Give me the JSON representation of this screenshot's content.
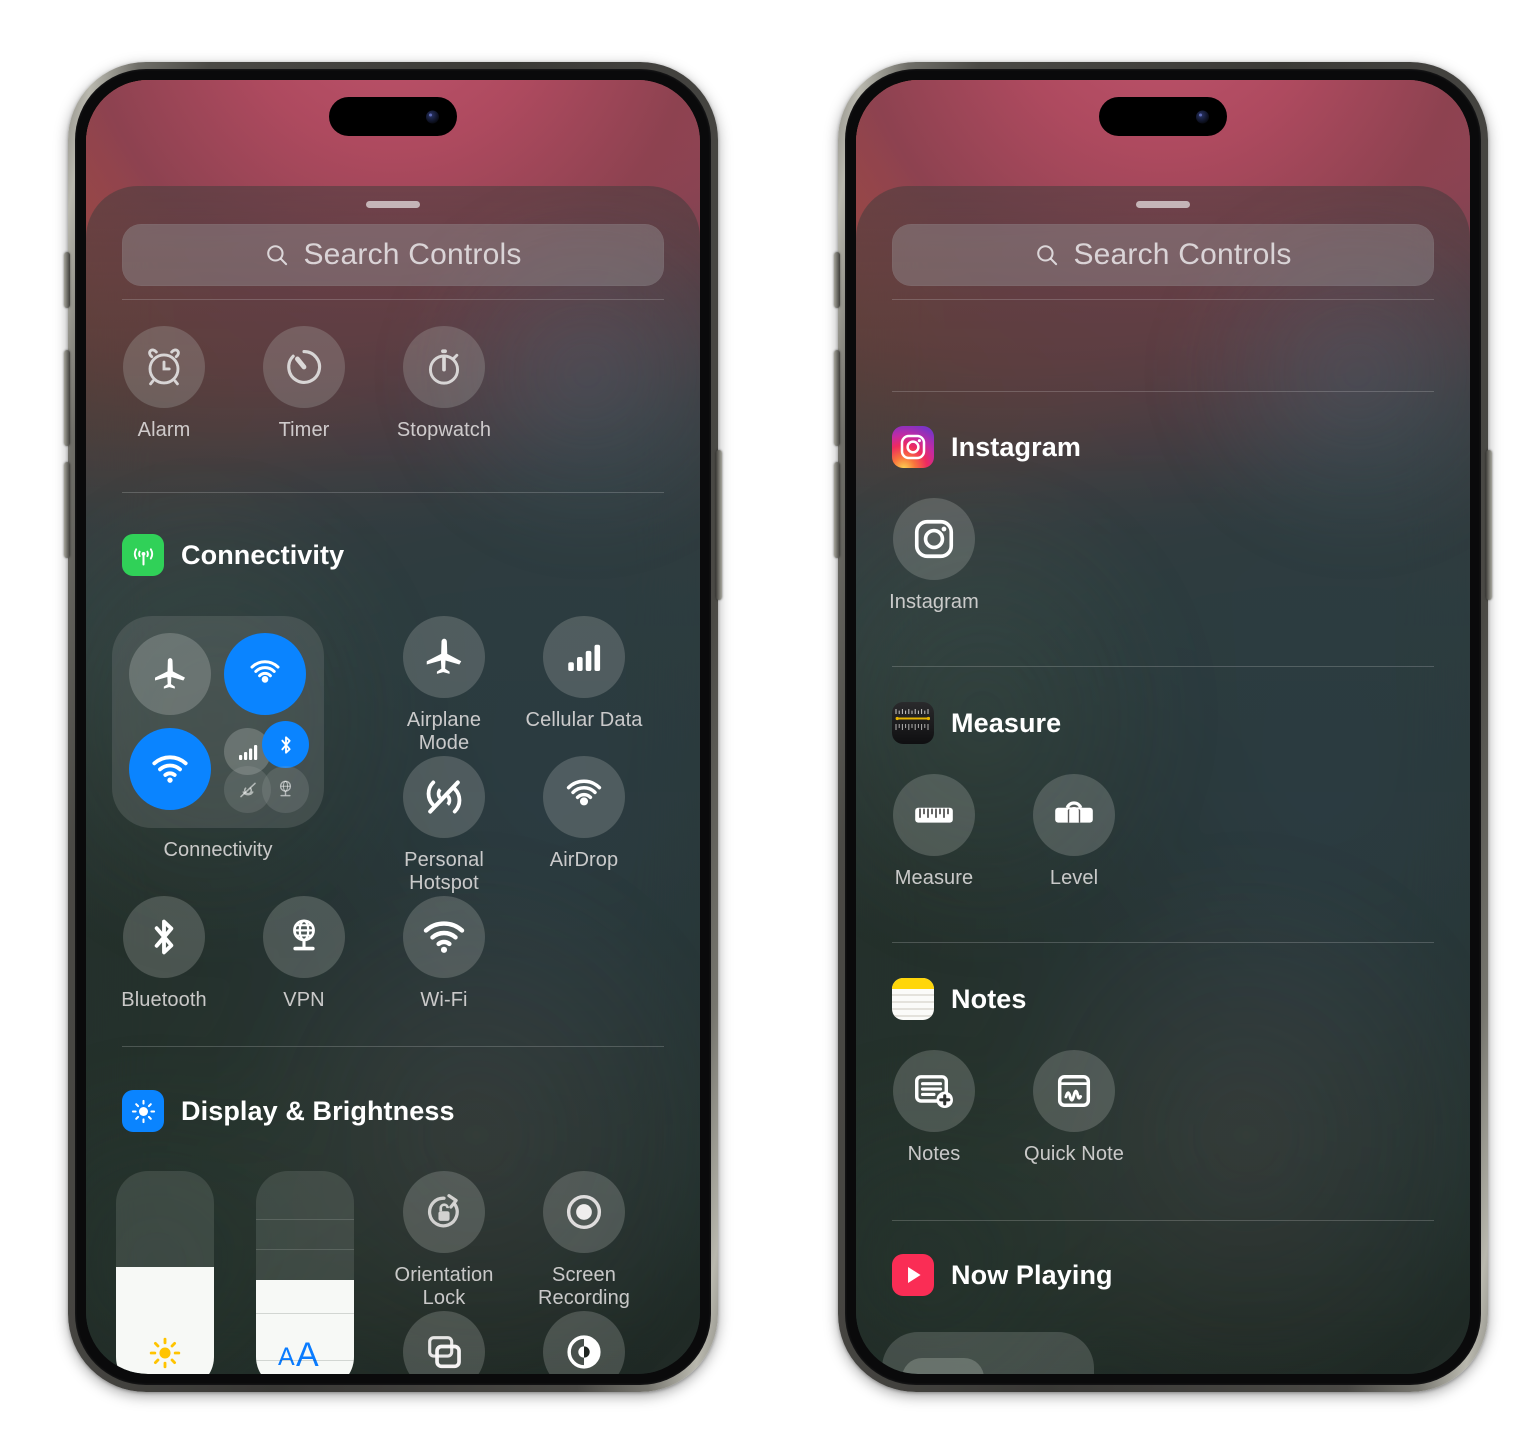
{
  "screenshot": {
    "description": "Two iPhone mockups showing iOS Control Center add-controls gallery",
    "accent_blue": "#0a84ff",
    "tile_label_color": "#e4e2e2"
  },
  "phone_left": {
    "search": {
      "placeholder": "Search Controls",
      "icon": "search-icon"
    },
    "sections": [
      {
        "id": "clock",
        "header": null,
        "tiles": [
          {
            "label": "Alarm",
            "icon": "alarm-clock-icon"
          },
          {
            "label": "Timer",
            "icon": "timer-icon"
          },
          {
            "label": "Stopwatch",
            "icon": "stopwatch-icon"
          }
        ]
      },
      {
        "id": "connectivity",
        "header": {
          "title": "Connectivity",
          "icon": "connectivity-app-icon",
          "icon_color": "#30d158"
        },
        "group": {
          "label": "Connectivity",
          "toggles": [
            {
              "name": "airplane-mode-toggle",
              "state": "off",
              "icon": "airplane-icon"
            },
            {
              "name": "cellular-data-toggle",
              "state": "on",
              "icon": "cellular-antenna-icon"
            },
            {
              "name": "wifi-toggle",
              "state": "on",
              "icon": "wifi-icon"
            },
            {
              "name": "cellular-bars-toggle",
              "state": "off",
              "icon": "cellular-bars-icon"
            },
            {
              "name": "bluetooth-toggle",
              "state": "on",
              "icon": "bluetooth-icon"
            },
            {
              "name": "airdrop-toggle",
              "state": "dim",
              "icon": "airdrop-off-icon"
            },
            {
              "name": "vpn-toggle",
              "state": "dim",
              "icon": "vpn-globe-icon"
            }
          ]
        },
        "tiles": [
          {
            "label": "Airplane Mode",
            "icon": "airplane-icon"
          },
          {
            "label": "Cellular Data",
            "icon": "cellular-bars-icon"
          },
          {
            "label": "Personal Hotspot",
            "icon": "hotspot-off-icon"
          },
          {
            "label": "AirDrop",
            "icon": "airdrop-icon"
          },
          {
            "label": "Bluetooth",
            "icon": "bluetooth-icon"
          },
          {
            "label": "VPN",
            "icon": "vpn-globe-icon"
          },
          {
            "label": "Wi-Fi",
            "icon": "wifi-icon"
          }
        ]
      },
      {
        "id": "display_brightness",
        "header": {
          "title": "Display & Brightness",
          "icon": "brightness-app-icon",
          "icon_color": "#0a84ff"
        },
        "sliders": [
          {
            "name": "brightness-slider",
            "icon": "sun-icon",
            "fill_percent": 56
          },
          {
            "name": "text-size-slider",
            "icon": "text-size-icon",
            "fill_percent": 50
          }
        ],
        "tiles": [
          {
            "label": "Orientation Lock",
            "icon": "rotation-lock-icon"
          },
          {
            "label": "Screen Recording",
            "icon": "screen-record-icon"
          },
          {
            "label": "",
            "icon": "stage-manager-icon"
          },
          {
            "label": "",
            "icon": "dark-mode-icon"
          }
        ]
      }
    ]
  },
  "phone_right": {
    "search": {
      "placeholder": "Search Controls",
      "icon": "search-icon"
    },
    "sections": [
      {
        "id": "instagram",
        "header": {
          "title": "Instagram",
          "icon": "instagram-app-icon"
        },
        "tiles": [
          {
            "label": "Instagram",
            "icon": "instagram-glyph-icon"
          }
        ]
      },
      {
        "id": "measure",
        "header": {
          "title": "Measure",
          "icon": "measure-app-icon"
        },
        "tiles": [
          {
            "label": "Measure",
            "icon": "ruler-icon"
          },
          {
            "label": "Level",
            "icon": "level-icon"
          }
        ]
      },
      {
        "id": "notes",
        "header": {
          "title": "Notes",
          "icon": "notes-app-icon",
          "icon_color": "#ffd60a"
        },
        "tiles": [
          {
            "label": "Notes",
            "icon": "new-note-icon"
          },
          {
            "label": "Quick Note",
            "icon": "quick-note-icon"
          }
        ]
      },
      {
        "id": "now_playing",
        "header": {
          "title": "Now Playing",
          "icon": "now-playing-app-icon",
          "icon_color": "#fa2d55"
        },
        "tiles": []
      }
    ]
  }
}
